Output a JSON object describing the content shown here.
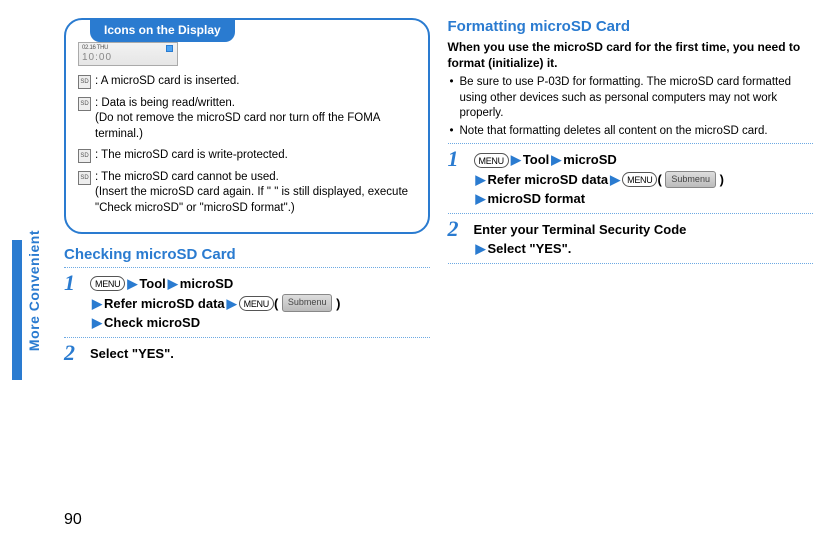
{
  "side_label": "More Convenient",
  "page_number": "90",
  "box": {
    "tab": "Icons on the Display",
    "display_line1": "02.16 THU",
    "display_line2": "10:00",
    "rows": [
      {
        "icon": "SD",
        "text": ": A microSD card is inserted."
      },
      {
        "icon": "SD",
        "text": ": Data is being read/written.",
        "sub": "(Do not remove the microSD card nor turn off the FOMA terminal.)"
      },
      {
        "icon": "SD",
        "text": ": The microSD card is write-protected."
      },
      {
        "icon": "SD",
        "text": ": The microSD card cannot be used.",
        "sub": "(Insert the microSD card again. If \" \" is still displayed, execute \"Check microSD\" or \"microSD format\".)"
      }
    ]
  },
  "check": {
    "heading": "Checking microSD Card",
    "step1": {
      "menu": "MENU",
      "tool": "Tool",
      "microsd": "microSD",
      "refer": "Refer microSD data",
      "submenu": "Submenu",
      "check": "Check microSD"
    },
    "step2": "Select \"YES\"."
  },
  "format": {
    "heading": "Formatting microSD Card",
    "intro": "When you use the microSD card for the first time, you need to format (initialize) it.",
    "bullets": [
      "Be sure to use P-03D for formatting. The microSD card formatted using other devices such as personal computers may not work properly.",
      "Note that formatting deletes all content on the microSD card."
    ],
    "step1": {
      "menu": "MENU",
      "tool": "Tool",
      "microsd": "microSD",
      "refer": "Refer microSD data",
      "submenu": "Submenu",
      "fmt": "microSD format"
    },
    "step2a": "Enter your Terminal Security Code",
    "step2b": "Select \"YES\"."
  }
}
